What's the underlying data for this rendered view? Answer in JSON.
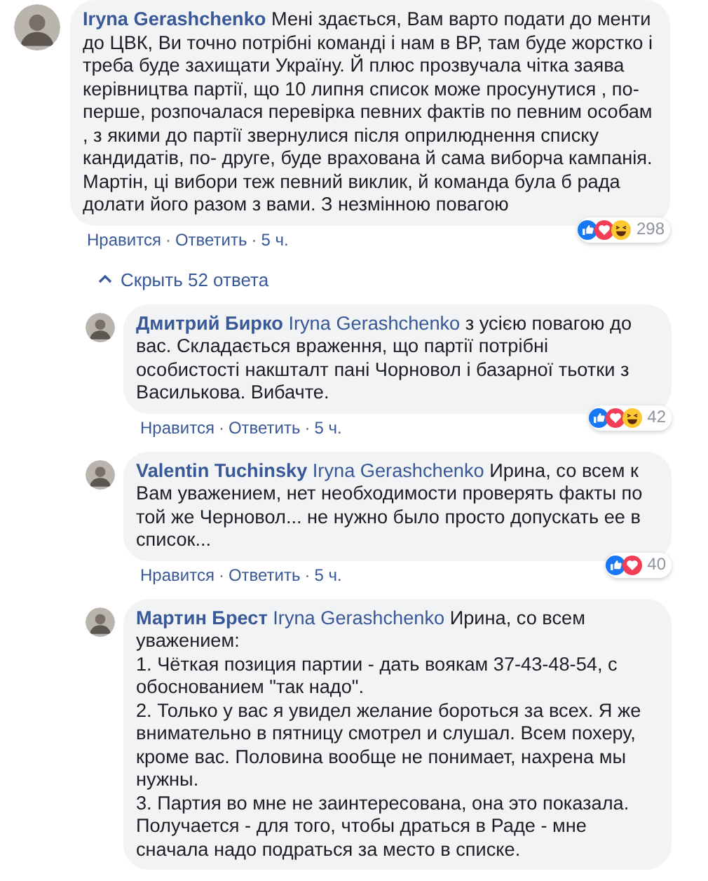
{
  "comment": {
    "author": "Iryna Gerashchenko",
    "text": "Мені здається, Вам варто подати до менти до ЦВК, Ви точно потрібні команді і нам в ВР, там буде жорстко і треба буде захищати Україну. Й плюс прозвучала чітка заява керівництва партії, що 10 липня список може просунутися , по-перше, розпочалася перевірка певних фактів по певним особам , з якими до партії звернулися після оприлюднення списку кандидатів, по- друге, буде врахована й сама виборча кампанія. Мартін, ці вибори теж певний виклик, й команда була б рада долати його разом з вами. З незмінною повагою",
    "reactions": [
      {
        "kind": "like"
      },
      {
        "kind": "love"
      },
      {
        "kind": "haha"
      }
    ],
    "reaction_count": "298",
    "actions": [
      "Нравится",
      "Ответить"
    ],
    "separator": "·",
    "time": "5 ч."
  },
  "hide_replies": "Скрыть 52 ответа",
  "replies": [
    {
      "author": "Дмитрий Бирко",
      "mention": "Iryna Gerashchenko",
      "text": "з усією повагою до вас. Складається враження, що партії потрібні особистості накшталт пані Чорновол і базарної тьотки з Василькова. Вибачте.",
      "reactions": [
        {
          "kind": "like"
        },
        {
          "kind": "love"
        },
        {
          "kind": "haha"
        }
      ],
      "reaction_count": "42",
      "actions": [
        "Нравится",
        "Ответить"
      ],
      "separator": "·",
      "time": "5 ч."
    },
    {
      "author": "Valentin Tuchinsky",
      "mention": "Iryna Gerashchenko",
      "text": "Ирина, со всем к Вам уважением, нет необходимости проверять факты по той же Черновол... не нужно было просто допускать ее в список...",
      "reactions": [
        {
          "kind": "like"
        },
        {
          "kind": "love"
        }
      ],
      "reaction_count": "40",
      "actions": [
        "Нравится",
        "Ответить"
      ],
      "separator": "·",
      "time": "5 ч."
    },
    {
      "author": "Мартин Брест",
      "mention": "Iryna Gerashchenko",
      "text": "Ирина, со всем уважением:\n1. Чёткая позиция партии - дать воякам 37-43-48-54, с обоснованием \"так надо\".\n2. Только у вас я увидел желание бороться за всех. Я же внимательно в пятницу смотрел и слушал. Всем похеру, кроме вас. Половина вообще не понимает, нахрена мы нужны.\n3. Партия во мне не заинтересована, она это показала. Получается - для того, чтобы драться в Раде - мне сначала надо подраться за место в списке."
    }
  ]
}
